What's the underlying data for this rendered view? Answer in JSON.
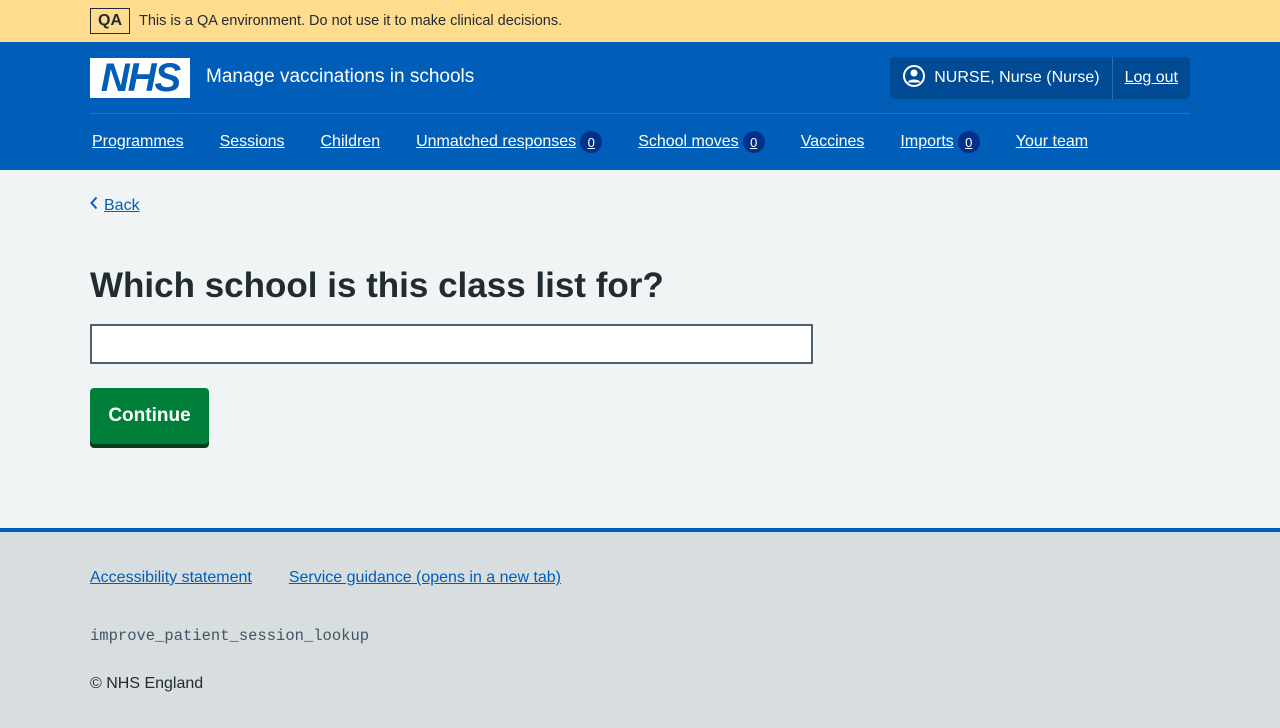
{
  "env_banner": {
    "tag": "QA",
    "message": "This is a QA environment. Do not use it to make clinical decisions."
  },
  "header": {
    "logo_text": "NHS",
    "service_name": "Manage vaccinations in schools",
    "account": {
      "user": "NURSE, Nurse (Nurse)",
      "logout": "Log out"
    },
    "nav": [
      {
        "label": "Programmes"
      },
      {
        "label": "Sessions"
      },
      {
        "label": "Children"
      },
      {
        "label": "Unmatched responses",
        "count": "0"
      },
      {
        "label": "School moves",
        "count": "0"
      },
      {
        "label": "Vaccines"
      },
      {
        "label": "Imports",
        "count": "0"
      },
      {
        "label": "Your team"
      }
    ]
  },
  "main": {
    "back_label": "Back",
    "heading": "Which school is this class list for?",
    "school_input_value": "",
    "continue_label": "Continue"
  },
  "footer": {
    "links": [
      {
        "label": "Accessibility statement"
      },
      {
        "label": "Service guidance (opens in a new tab)"
      }
    ],
    "branch": "improve_patient_session_lookup",
    "copyright": "© NHS England"
  },
  "colors": {
    "env_banner_bg": "#ffdc8e",
    "nhs_blue": "#005eb8",
    "account_bg": "#004b93",
    "count_badge_bg": "#003087",
    "page_bg": "#f0f4f5",
    "button_green": "#007f3b",
    "footer_bg": "#d8dde0"
  },
  "icons": {
    "account": "user-circle-icon",
    "back": "chevron-left-icon"
  }
}
